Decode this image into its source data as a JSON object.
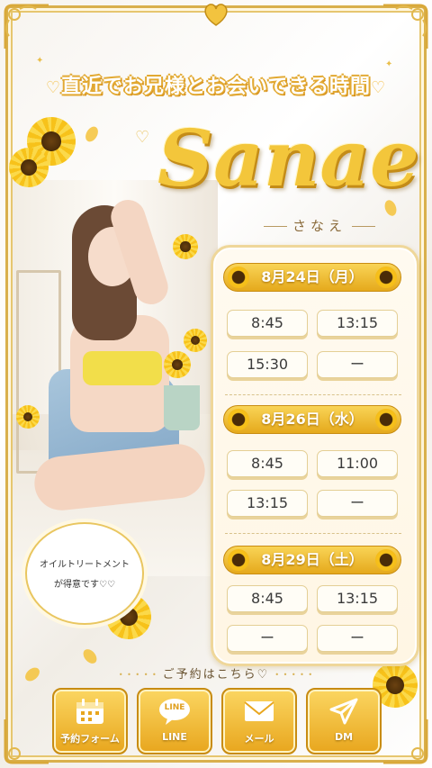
{
  "header": {
    "heart_left": "♡",
    "headline": "直近でお兄様とお会いできる時間",
    "heart_right": "♡"
  },
  "profile": {
    "name": "Sanae",
    "kana": "さなえ",
    "bubble_line1": "オイルトリートメント",
    "bubble_line2": "が得意です♡♡"
  },
  "schedule": [
    {
      "date": "8月24日（月）",
      "slots": [
        "8:45",
        "13:15",
        "15:30",
        "ー"
      ]
    },
    {
      "date": "8月26日（水）",
      "slots": [
        "8:45",
        "11:00",
        "13:15",
        "ー"
      ]
    },
    {
      "date": "8月29日（土）",
      "slots": [
        "8:45",
        "13:15",
        "ー",
        "ー"
      ]
    }
  ],
  "reserve": {
    "title": "ご予約はこちら♡",
    "buttons": [
      {
        "label": "予約フォーム",
        "icon": "calendar-icon"
      },
      {
        "label": "LINE",
        "icon_text": "LINE",
        "icon": "line-icon"
      },
      {
        "label": "メール",
        "icon": "mail-icon"
      },
      {
        "label": "DM",
        "icon": "send-icon"
      }
    ]
  },
  "colors": {
    "gold": "#e5a91c",
    "gold_light": "#f9d456",
    "frame": "#d9b04c"
  }
}
